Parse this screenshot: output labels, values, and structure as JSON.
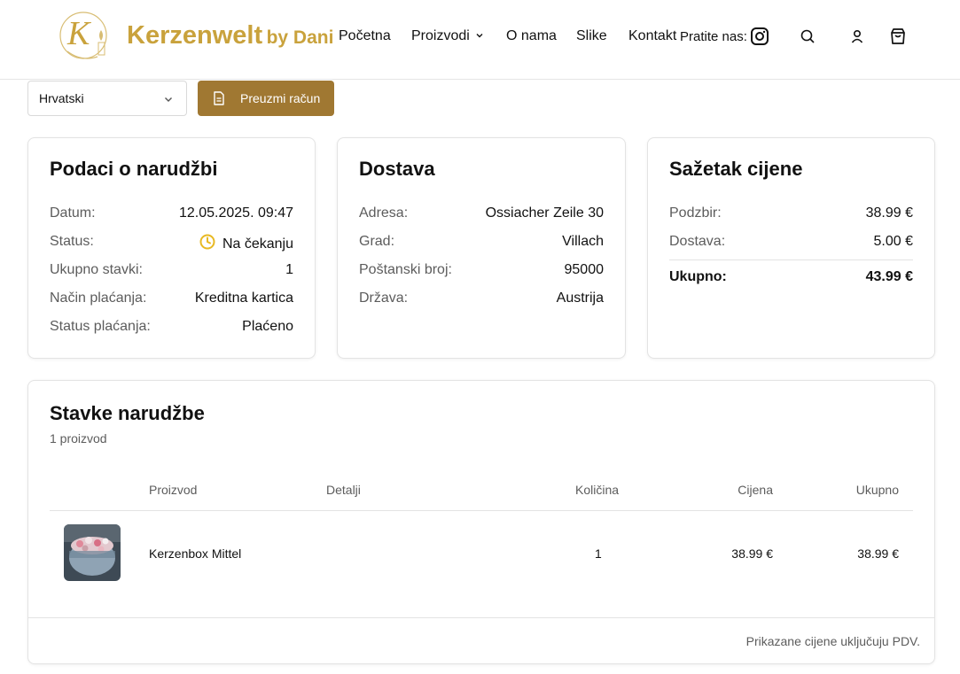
{
  "brand": {
    "name": "Kerzenwelt",
    "suffix": "by Dani",
    "monogram": "K",
    "accent_color": "#c9a23c",
    "button_color": "#a07832"
  },
  "nav": {
    "items": [
      "Početna",
      "Proizvodi",
      "O nama",
      "Slike",
      "Kontakt"
    ],
    "follow_label": "Pratite nas:",
    "icons": [
      "instagram-icon",
      "search-icon",
      "user-icon",
      "shopping-bag-icon"
    ]
  },
  "toolbar": {
    "language": "Hrvatski",
    "invoice_button": "Preuzmi račun"
  },
  "order_info": {
    "title": "Podaci o narudžbi",
    "rows": [
      {
        "label": "Datum:",
        "value": "12.05.2025. 09:47"
      },
      {
        "label": "Status:",
        "value": "Na čekanju"
      },
      {
        "label": "Ukupno stavki:",
        "value": "1"
      },
      {
        "label": "Način plaćanja:",
        "value": "Kreditna kartica"
      },
      {
        "label": "Status plaćanja:",
        "value": "Plaćeno"
      }
    ],
    "status_color": "#e8b923"
  },
  "shipping": {
    "title": "Dostava",
    "rows": [
      {
        "label": "Adresa:",
        "value": "Ossiacher Zeile 30"
      },
      {
        "label": "Grad:",
        "value": "Villach"
      },
      {
        "label": "Poštanski broj:",
        "value": "95000"
      },
      {
        "label": "Država:",
        "value": "Austrija"
      }
    ]
  },
  "price_summary": {
    "title": "Sažetak cijene",
    "rows": [
      {
        "label": "Podzbir:",
        "value": "38.99 €"
      },
      {
        "label": "Dostava:",
        "value": "5.00 €"
      }
    ],
    "total": {
      "label": "Ukupno:",
      "value": "43.99 €"
    }
  },
  "items": {
    "title": "Stavke narudžbe",
    "count": "1 proizvod",
    "columns": [
      "Proizvod",
      "Detalji",
      "Količina",
      "Cijena",
      "Ukupno"
    ],
    "rows": [
      {
        "name": "Kerzenbox Mittel",
        "details": "",
        "qty": "1",
        "price": "38.99 €",
        "total": "38.99 €"
      }
    ],
    "note": "Prikazane cijene uključuju PDV."
  }
}
